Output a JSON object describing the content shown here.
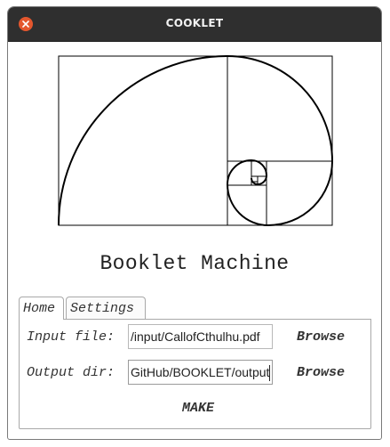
{
  "window": {
    "title": "COOKLET"
  },
  "icons": {
    "close": "close-icon",
    "logo": "fibonacci-spiral-logo"
  },
  "colors": {
    "titlebar": "#2f2f2f",
    "close": "#e4572e"
  },
  "main": {
    "heading": "Booklet Machine"
  },
  "tabs": [
    {
      "label": "Home",
      "active": true
    },
    {
      "label": "Settings",
      "active": false
    }
  ],
  "home": {
    "input_label": "Input file:",
    "input_value": "/input/CallofCthulhu.pdf",
    "output_label": "Output dir:",
    "output_value": "GitHub/BOOKLET/output",
    "browse_input": "Browse",
    "browse_output": "Browse",
    "make": "MAKE"
  }
}
